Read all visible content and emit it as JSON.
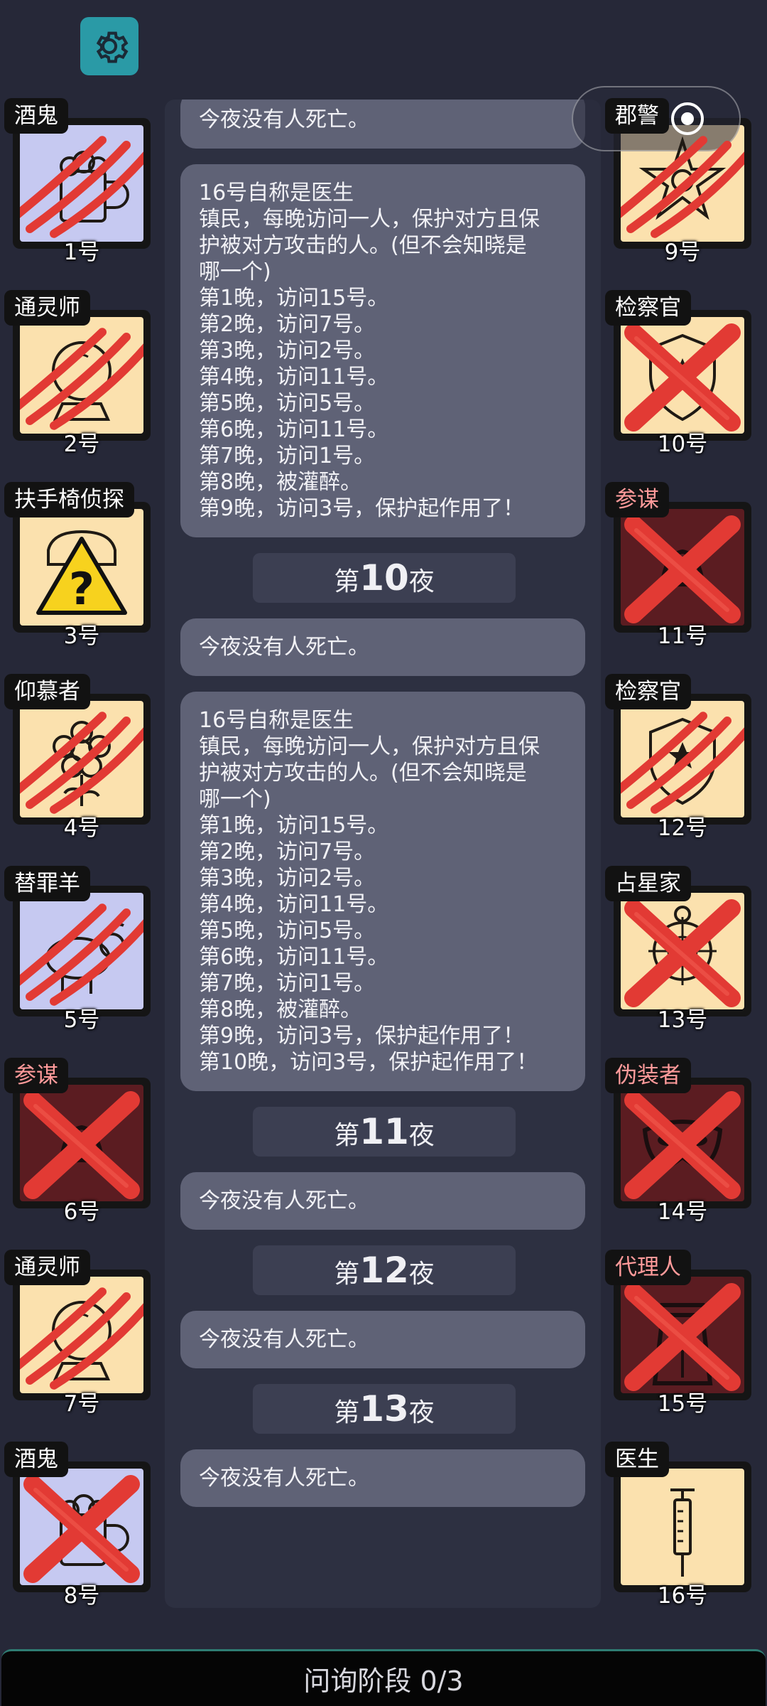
{
  "status_bar": {
    "capsule": [
      "more-dots-icon",
      "target-icon"
    ]
  },
  "players_left": [
    {
      "role": "酒鬼",
      "number": "1号",
      "bg": "lav",
      "mark": "claw",
      "role_red": false,
      "icon": "beer-mug-icon"
    },
    {
      "role": "通灵师",
      "number": "2号",
      "bg": "cream",
      "mark": "claw",
      "role_red": false,
      "icon": "crystal-ball-icon"
    },
    {
      "role": "扶手椅侦探",
      "number": "3号",
      "bg": "cream",
      "mark": "none",
      "role_red": false,
      "icon": "warning-question-icon"
    },
    {
      "role": "仰慕者",
      "number": "4号",
      "bg": "cream",
      "mark": "claw",
      "role_red": false,
      "icon": "flower-icon"
    },
    {
      "role": "替罪羊",
      "number": "5号",
      "bg": "lav",
      "mark": "claw",
      "role_red": false,
      "icon": "goat-icon"
    },
    {
      "role": "参谋",
      "number": "6号",
      "bg": "maroon",
      "mark": "x",
      "role_red": true,
      "icon": "hat-icon"
    },
    {
      "role": "通灵师",
      "number": "7号",
      "bg": "cream",
      "mark": "claw",
      "role_red": false,
      "icon": "crystal-ball-icon"
    },
    {
      "role": "酒鬼",
      "number": "8号",
      "bg": "lav",
      "mark": "x",
      "role_red": false,
      "icon": "beer-mug-icon"
    }
  ],
  "players_right": [
    {
      "role": "郡警",
      "number": "9号",
      "bg": "cream",
      "mark": "claw",
      "role_red": false,
      "icon": "sheriff-star-icon"
    },
    {
      "role": "检察官",
      "number": "10号",
      "bg": "cream",
      "mark": "x",
      "role_red": false,
      "icon": "badge-icon"
    },
    {
      "role": "参谋",
      "number": "11号",
      "bg": "maroon",
      "mark": "x",
      "role_red": true,
      "icon": "hat-icon"
    },
    {
      "role": "检察官",
      "number": "12号",
      "bg": "cream",
      "mark": "claw",
      "role_red": false,
      "icon": "badge-icon"
    },
    {
      "role": "占星家",
      "number": "13号",
      "bg": "cream",
      "mark": "x",
      "role_red": false,
      "icon": "astrolabe-icon"
    },
    {
      "role": "伪装者",
      "number": "14号",
      "bg": "maroon",
      "mark": "x",
      "role_red": true,
      "icon": "mask-icon"
    },
    {
      "role": "代理人",
      "number": "15号",
      "bg": "maroon",
      "mark": "x",
      "role_red": true,
      "icon": "coat-icon"
    },
    {
      "role": "医生",
      "number": "16号",
      "bg": "cream",
      "mark": "none",
      "role_red": false,
      "icon": "syringe-icon"
    }
  ],
  "feed": [
    {
      "type": "msg",
      "lines": [
        "今夜没有人死亡。"
      ]
    },
    {
      "type": "msg",
      "lines": [
        "16号自称是医生",
        "镇民，每晚访问一人，保护对方且保",
        "护被对方攻击的人。(但不会知晓是",
        "哪一个)",
        "第1晚，访问15号。",
        "第2晚，访问7号。",
        "第3晚，访问2号。",
        "第4晚，访问11号。",
        "第5晚，访问5号。",
        "第6晚，访问11号。",
        "第7晚，访问1号。",
        "第8晚，被灌醉。",
        "第9晚，访问3号，保护起作用了！"
      ]
    },
    {
      "type": "night",
      "prefix": "第",
      "number": "10",
      "suffix": "夜"
    },
    {
      "type": "msg",
      "lines": [
        "今夜没有人死亡。"
      ]
    },
    {
      "type": "msg",
      "lines": [
        "16号自称是医生",
        "镇民，每晚访问一人，保护对方且保",
        "护被对方攻击的人。(但不会知晓是",
        "哪一个)",
        "第1晚，访问15号。",
        "第2晚，访问7号。",
        "第3晚，访问2号。",
        "第4晚，访问11号。",
        "第5晚，访问5号。",
        "第6晚，访问11号。",
        "第7晚，访问1号。",
        "第8晚，被灌醉。",
        "第9晚，访问3号，保护起作用了！",
        "第10晚，访问3号，保护起作用了！"
      ]
    },
    {
      "type": "night",
      "prefix": "第",
      "number": "11",
      "suffix": "夜"
    },
    {
      "type": "msg",
      "lines": [
        "今夜没有人死亡。"
      ]
    },
    {
      "type": "night",
      "prefix": "第",
      "number": "12",
      "suffix": "夜"
    },
    {
      "type": "msg",
      "lines": [
        "今夜没有人死亡。"
      ]
    },
    {
      "type": "night",
      "prefix": "第",
      "number": "13",
      "suffix": "夜"
    },
    {
      "type": "msg",
      "lines": [
        "今夜没有人死亡。"
      ]
    }
  ],
  "bottom_bar": {
    "label": "问询阶段 0/3"
  },
  "colors": {
    "background": "#262838",
    "accent": "#2a9aa6",
    "mark_red": "#e23a34"
  }
}
